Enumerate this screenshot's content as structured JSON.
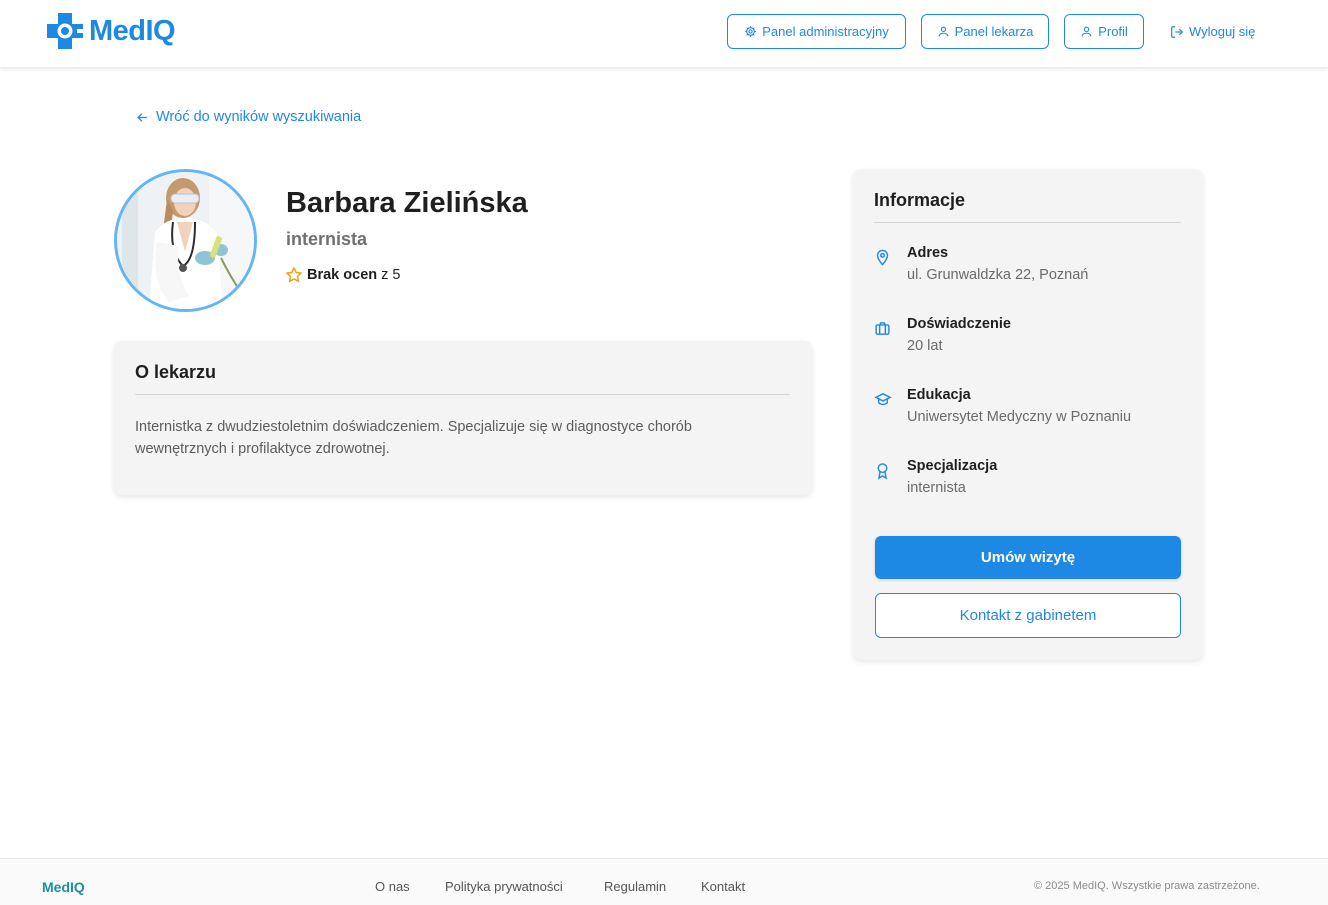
{
  "header": {
    "brand": "MedIQ",
    "nav": {
      "admin_panel": "Panel administracyjny",
      "doctor_panel": "Panel lekarza",
      "profile": "Profil",
      "logout": "Wyloguj się"
    }
  },
  "back_link": "Wróć do wyników wyszukiwania",
  "doctor": {
    "name": "Barbara Zielińska",
    "specialty": "internista",
    "rating_label": "Brak ocen",
    "rating_suffix": "z 5"
  },
  "about": {
    "title": "O lekarzu",
    "text": "Internistka z dwudziestoletnim doświadczeniem. Specjalizuje się w diagnostyce chorób wewnętrznych i profilaktyce zdrowotnej."
  },
  "info": {
    "title": "Informacje",
    "items": [
      {
        "label": "Adres",
        "value": "ul. Grunwaldzka 22, Poznań",
        "icon": "map-pin-icon"
      },
      {
        "label": "Doświadczenie",
        "value": "20 lat",
        "icon": "briefcase-icon"
      },
      {
        "label": "Edukacja",
        "value": "Uniwersytet Medyczny w Poznaniu",
        "icon": "graduation-cap-icon"
      },
      {
        "label": "Specjalizacja",
        "value": "internista",
        "icon": "award-icon"
      }
    ],
    "book_button": "Umów wizytę",
    "contact_button": "Kontakt z gabinetem"
  },
  "footer": {
    "brand": "MedIQ",
    "links": [
      "O nas",
      "Polityka prywatności",
      "Regulamin",
      "Kontakt"
    ],
    "copyright": "© 2025 MedIQ. Wszystkie prawa zastrzeżone."
  },
  "colors": {
    "accent": "#1e88e5",
    "rating_star": "#f2a20c",
    "avatar_ring": "#64b5f6",
    "footer_brand": "#1b8fa8"
  }
}
